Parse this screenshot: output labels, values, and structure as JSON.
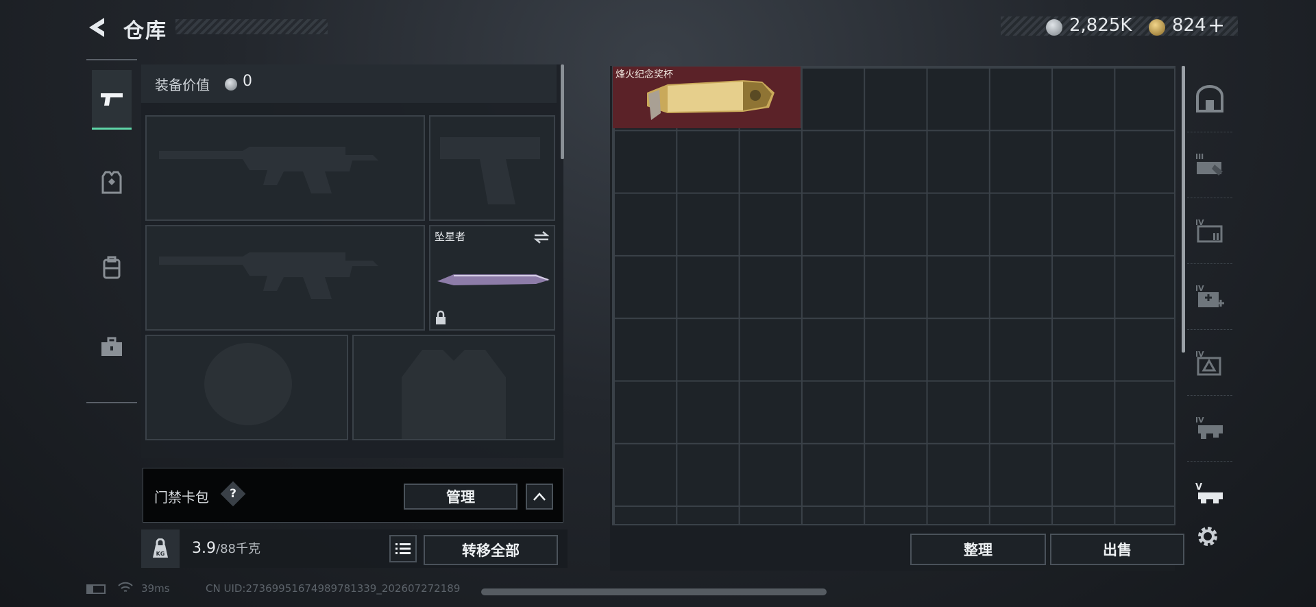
{
  "header": {
    "title": "仓库",
    "currency": [
      {
        "icon": "silver-coin-icon",
        "value": "2,825K",
        "color": "#a8aeb4"
      },
      {
        "icon": "gold-coin-icon",
        "value": "824",
        "add": "+",
        "color": "#c9a65a"
      }
    ]
  },
  "tabs": [
    {
      "name": "weapons",
      "icon": "pistol-icon",
      "active": true
    },
    {
      "name": "armor",
      "icon": "vest-icon",
      "active": false
    },
    {
      "name": "backpack",
      "icon": "backpack-icon",
      "active": false
    },
    {
      "name": "tools",
      "icon": "toolbox-icon",
      "active": false
    }
  ],
  "equipment": {
    "value_label": "装备价值",
    "value": "0",
    "melee_name": "坠星者"
  },
  "card_pack": {
    "label": "门禁卡包",
    "help": "?",
    "manage_label": "管理"
  },
  "bottom": {
    "weight_current": "3.9",
    "weight_max": "/88千克",
    "weight_icon_label": "KG",
    "transfer_label": "转移全部"
  },
  "storage": {
    "item_name": "烽火纪念奖杯",
    "sort_label": "整理",
    "sell_label": "出售"
  },
  "right_icons": [
    {
      "icon": "safe-box-icon"
    },
    {
      "icon": "tier-iii-gun-case-icon",
      "tier": "III"
    },
    {
      "icon": "tier-iv-ammo-box-icon",
      "tier": "IV"
    },
    {
      "icon": "tier-iv-medkit-icon",
      "tier": "IV"
    },
    {
      "icon": "tier-iv-gear-case-icon",
      "tier": "IV"
    },
    {
      "icon": "tier-iv-rifle-case-icon",
      "tier": "IV"
    },
    {
      "icon": "tier-v-rifle-case-icon",
      "tier": "V"
    }
  ],
  "status_bar": {
    "ping": "39ms",
    "uid": "CN UID:2736995167498978133​9_202607272189"
  }
}
